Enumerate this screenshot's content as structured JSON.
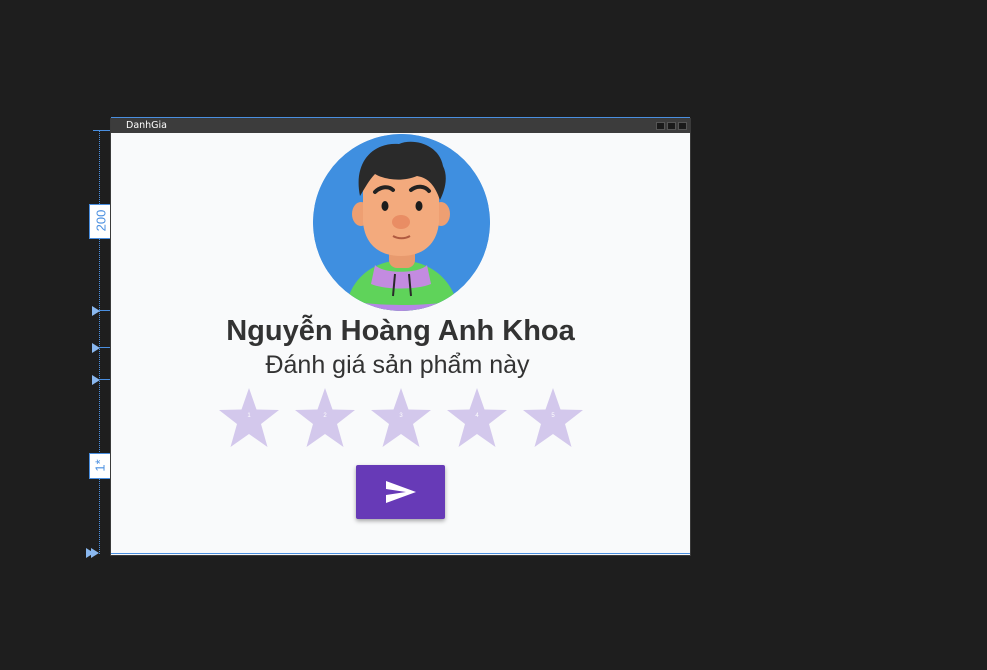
{
  "window": {
    "title": "DanhGia"
  },
  "profile": {
    "name": "Nguyễn Hoàng Anh Khoa",
    "subtitle": "Đánh giá sản phẩm này"
  },
  "rating": {
    "stars": [
      {
        "label": "1"
      },
      {
        "label": "2"
      },
      {
        "label": "3"
      },
      {
        "label": "4"
      },
      {
        "label": "5"
      }
    ],
    "value": 0,
    "star_color": "#d3c8ec"
  },
  "send_button": {
    "icon": "send-icon",
    "color": "#673ab7"
  },
  "designer": {
    "row1_height": "200",
    "row2_height": "1*",
    "guide_color": "#4a8fe0"
  }
}
